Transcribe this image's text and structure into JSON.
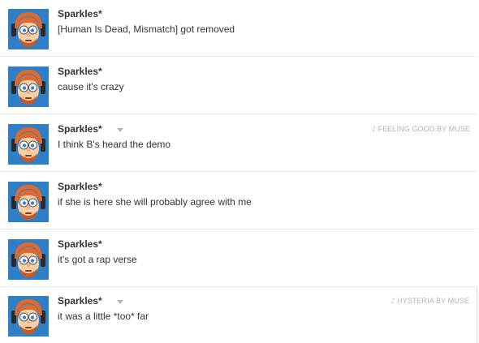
{
  "messages": [
    {
      "author": "Sparkles*",
      "text": "[Human Is Dead, Mismatch] got removed",
      "song_icon": "",
      "song": "",
      "avatar_icon": "redhead-headphones-avatar"
    },
    {
      "author": "Sparkles*",
      "text": "cause it's crazy",
      "song_icon": "",
      "song": "",
      "avatar_icon": "redhead-headphones-avatar"
    },
    {
      "author": "Sparkles*",
      "text": "I think B's heard the demo",
      "song_icon": "♪",
      "song": "FEELING GOOD BY MUSE",
      "avatar_icon": "redhead-headphones-avatar"
    },
    {
      "author": "Sparkles*",
      "text": "if she is here she will probably agree with me",
      "song_icon": "",
      "song": "",
      "avatar_icon": "redhead-headphones-avatar"
    },
    {
      "author": "Sparkles*",
      "text": "it's got a rap verse",
      "song_icon": "",
      "song": "",
      "avatar_icon": "redhead-headphones-avatar"
    },
    {
      "author": "Sparkles*",
      "text": "it was a little *too* far",
      "song_icon": "♪",
      "song": "HYSTERIA BY MUSE",
      "avatar_icon": "redhead-headphones-avatar"
    }
  ],
  "colors": {
    "avatar_bg": "#2f7fc6",
    "hair": "#e06a2e",
    "skin": "#f4cfa8",
    "meta_text": "#b3b3b3"
  }
}
